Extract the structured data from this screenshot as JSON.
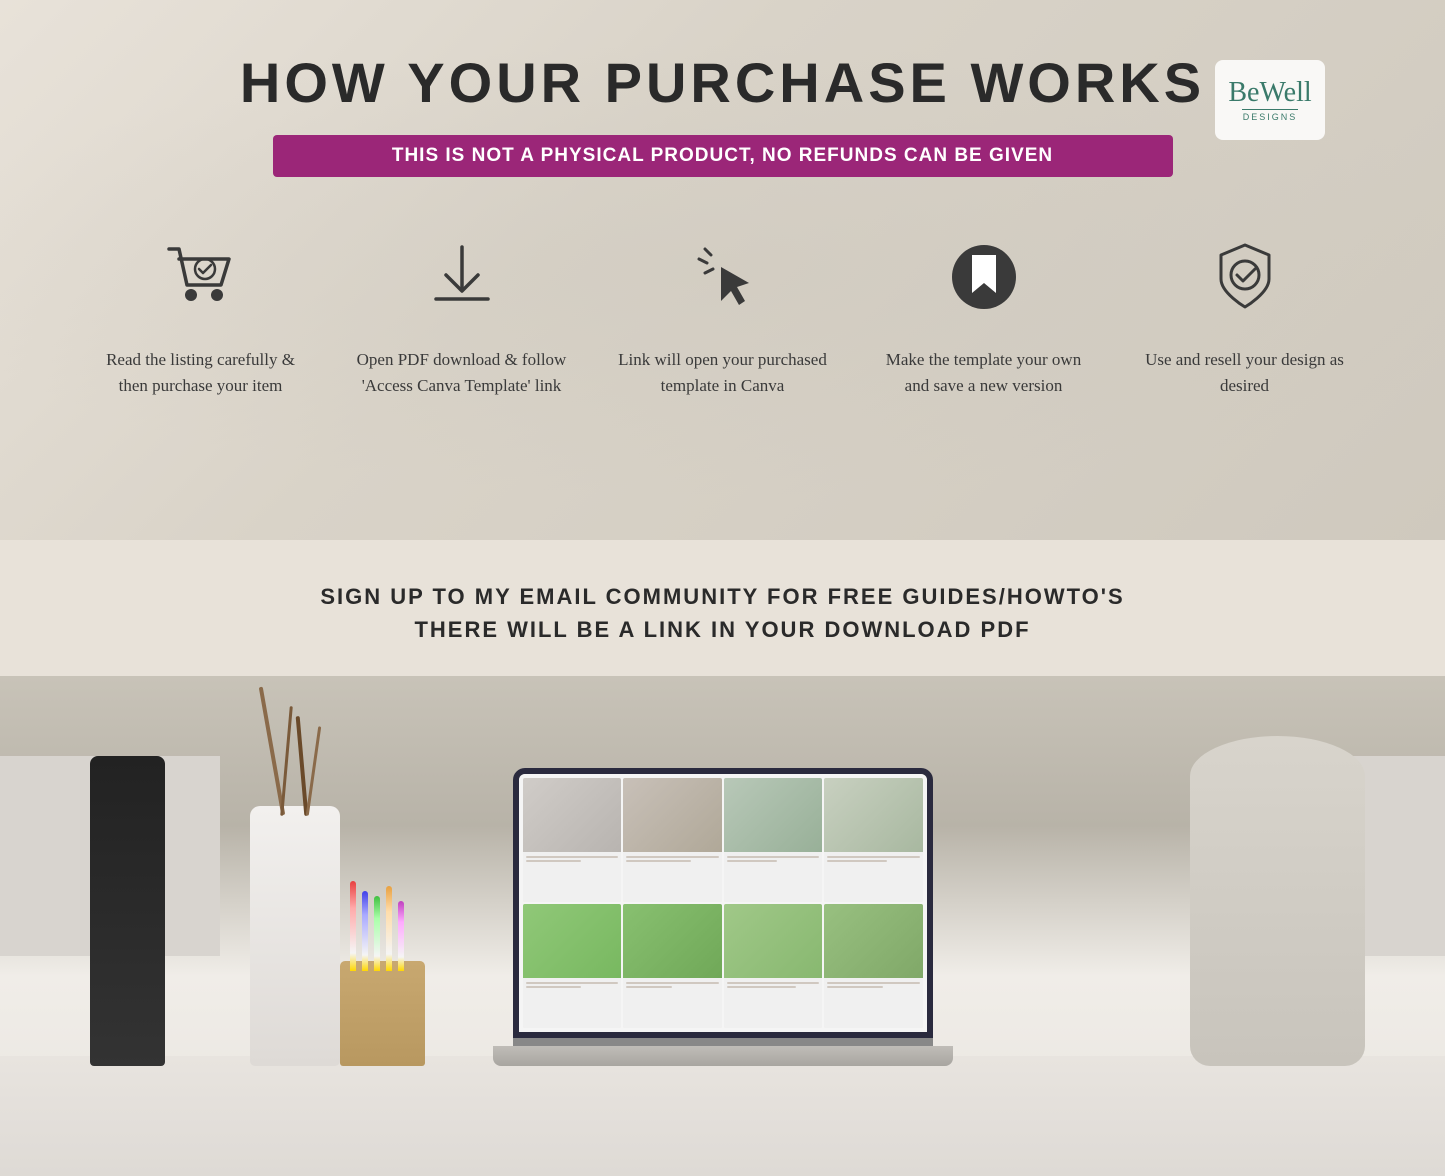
{
  "page": {
    "title": "HOW YOUR PURCHASE WORKS",
    "warning": "THIS IS NOT A PHYSICAL PRODUCT, NO REFUNDS CAN BE GIVEN",
    "signup": {
      "line1": "SIGN UP TO MY EMAIL COMMUNITY FOR FREE GUIDES/HOWTO'S",
      "line2": "THERE WILL BE A LINK IN YOUR DOWNLOAD PDF"
    }
  },
  "logo": {
    "text": "BeWell",
    "sub": "DESIGNS"
  },
  "steps": [
    {
      "id": 1,
      "icon": "cart-check-icon",
      "text": "Read the listing carefully & then purchase your item"
    },
    {
      "id": 2,
      "icon": "download-icon",
      "text": "Open PDF download & follow 'Access Canva Template' link"
    },
    {
      "id": 3,
      "icon": "cursor-click-icon",
      "text": "Link will open your purchased template in Canva"
    },
    {
      "id": 4,
      "icon": "bookmark-circle-icon",
      "text": "Make the template your own and save a new version"
    },
    {
      "id": 5,
      "icon": "shield-check-icon",
      "text": "Use and resell your design as desired"
    }
  ]
}
